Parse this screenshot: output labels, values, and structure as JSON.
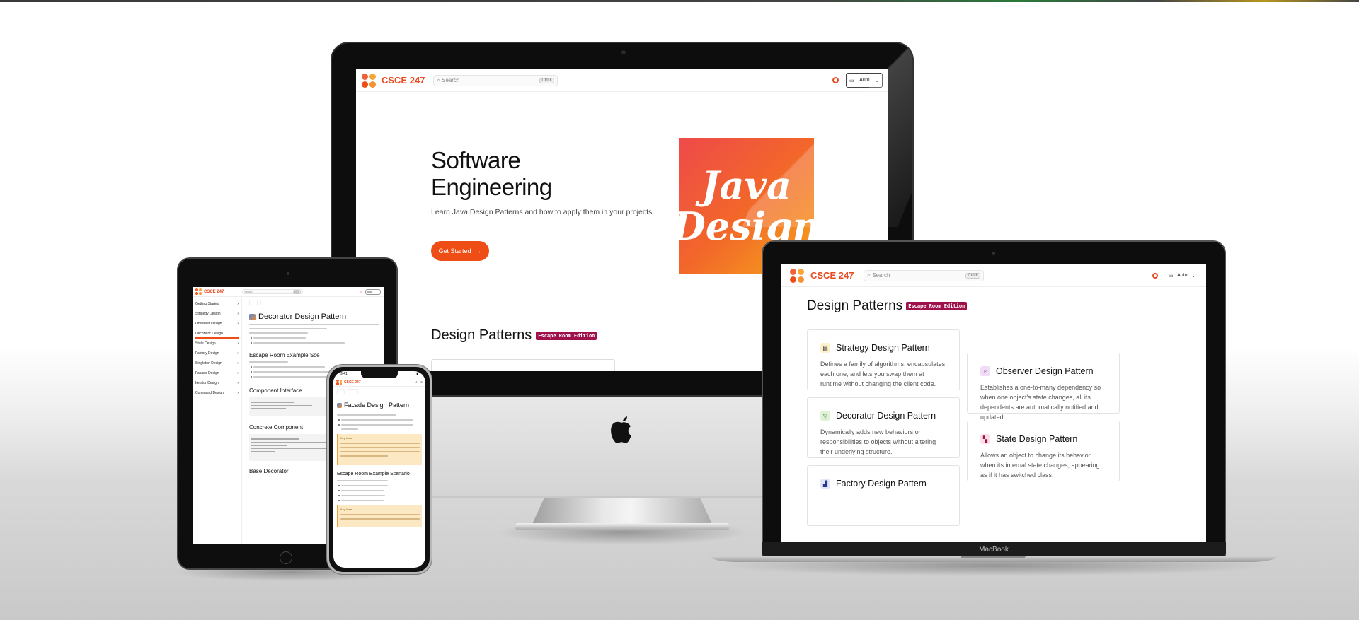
{
  "site": {
    "brand": "CSCE 247",
    "search_placeholder": "Search",
    "search_shortcut": "Ctrl K",
    "theme_label": "Auto",
    "logo_colors": [
      "#f0623a",
      "#f7a535",
      "#ee4e15",
      "#f59233"
    ],
    "accent": "#ee4e15",
    "badge_color": "#a0104a"
  },
  "imac": {
    "hero_title": "Software Engineering",
    "hero_subtitle": "Learn Java Design Patterns and how to apply them in your projects.",
    "cta_label": "Get Started",
    "cta_icon": "arrow-right-icon",
    "image_line1": "Java",
    "image_line2": "Design",
    "section_title": "Design Patterns",
    "section_badge": "Escape Room Edition"
  },
  "macbook": {
    "label": "MacBook",
    "title": "Design Patterns",
    "badge": "Escape Room Edition",
    "cards": [
      {
        "title": "Strategy Design Pattern",
        "icon": "document-icon",
        "icon_bg": "#fdf0cc",
        "desc": "Defines a family of algorithms, encapsulates each one, and lets you swap them at runtime without changing the client code."
      },
      {
        "title": "Observer Design Pattern",
        "icon": "magnifier-icon",
        "icon_bg": "#f1dcf5",
        "desc": "Establishes a one-to-many dependency so when one object's state changes, all its dependents are automatically notified and updated."
      },
      {
        "title": "Decorator Design Pattern",
        "icon": "shield-icon",
        "icon_bg": "#dff2d6",
        "desc": "Dynamically adds new behaviors or responsibilities to objects without altering their underlying structure."
      },
      {
        "title": "State Design Pattern",
        "icon": "state-icon",
        "icon_bg": "#fde0e6",
        "desc": "Allows an object to change its behavior when its internal state changes, appearing as if it has switched class."
      },
      {
        "title": "Factory Design Pattern",
        "icon": "factory-icon",
        "icon_bg": "#e3e6fa",
        "desc": ""
      }
    ]
  },
  "ipad": {
    "page_title": "Decorator Design Pattern",
    "section1": "Escape Room Example Sce",
    "section2": "Component Interface",
    "section3": "Concrete Component",
    "section4": "Base Decorator",
    "sidebar": [
      "Getting Started",
      "Strategy Design",
      "Observer Design",
      "Decorator Design",
      "State Design",
      "Factory Design",
      "Singleton Design",
      "Facade Design",
      "Iterator Design",
      "Command Design"
    ]
  },
  "iphone": {
    "time": "9:41",
    "page_title": "Facade Design Pattern",
    "section1": "Escape Room Example Scenario",
    "note_label": "Key Idea"
  }
}
